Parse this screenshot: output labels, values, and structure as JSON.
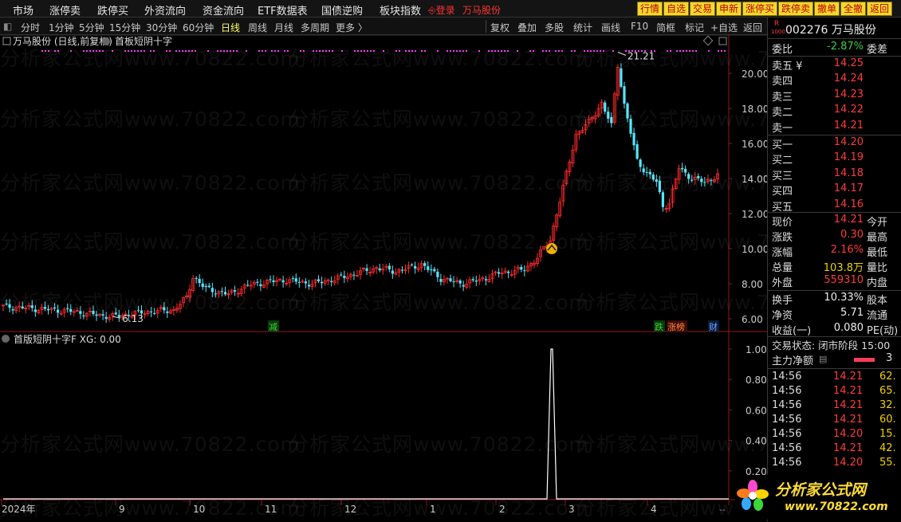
{
  "menu": {
    "items": [
      "市场",
      "涨停卖",
      "跌停买",
      "外资流向",
      "资金流向",
      "ETF数据表",
      "国债逆购",
      "板块指数"
    ],
    "login": "登录",
    "stock_name_red": "万马股份",
    "quick_buttons": [
      "行情",
      "自选",
      "交易",
      "申新",
      "涨停买",
      "跌停卖",
      "撤单",
      "全撤",
      "返回"
    ]
  },
  "toolbar": {
    "periods": [
      "分时",
      "1分钟",
      "5分钟",
      "15分钟",
      "30分钟",
      "60分钟",
      "日线",
      "周线",
      "月线",
      "多周期",
      "更多 〉"
    ],
    "active_period": "日线",
    "right_tools": [
      "复权",
      "叠加",
      "多股",
      "统计",
      "画线",
      "F10",
      "简框",
      "标记",
      "+自选",
      "返回"
    ]
  },
  "chart": {
    "title": "万马股份 (日线,前复权)",
    "indicator": "首板短阴十字",
    "price_axis": [
      "20.00",
      "18.00",
      "16.00",
      "14.00",
      "12.00",
      "10.00",
      "8.00",
      "6.00"
    ],
    "high_label": "21.21",
    "low_label": "6.13",
    "markers": {
      "reduce": "减",
      "drop": "跌",
      "limit": "涨榜",
      "fin": "财"
    },
    "sub_title": "首版短阴十字F  XG: 0.00",
    "sub_axis": [
      "1.00",
      "0.80",
      "0.60",
      "0.40",
      "0.20"
    ],
    "x_axis": [
      "2024年",
      "9",
      "10",
      "11",
      "12",
      "1",
      "2",
      "3",
      "4"
    ],
    "watermark": "分析家公式网www.70822.com"
  },
  "chart_data": {
    "type": "candlestick",
    "price_range": [
      5.5,
      21.5
    ],
    "high": 21.21,
    "low": 6.13,
    "indicator_series": {
      "name": "XG",
      "range": [
        0,
        1
      ],
      "signal_value": 1.0
    }
  },
  "panel": {
    "logo_letter": "R",
    "logo_sub": "1000",
    "code": "002276",
    "name": "万马股份",
    "weibi_label": "委比",
    "weibi_value": "-2.87%",
    "weicha_label": "委差",
    "sell": [
      {
        "label": "卖五 ¥",
        "price": "14.25"
      },
      {
        "label": "卖四",
        "price": "14.24"
      },
      {
        "label": "卖三",
        "price": "14.23"
      },
      {
        "label": "卖二",
        "price": "14.22"
      },
      {
        "label": "卖一",
        "price": "14.21"
      }
    ],
    "buy": [
      {
        "label": "买一",
        "price": "14.20"
      },
      {
        "label": "买二",
        "price": "14.19"
      },
      {
        "label": "买三",
        "price": "14.18"
      },
      {
        "label": "买四",
        "price": "14.17"
      },
      {
        "label": "买五",
        "price": "14.16"
      }
    ],
    "stats": [
      {
        "label": "现价",
        "value": "14.21",
        "color": "red",
        "right": "今开"
      },
      {
        "label": "涨跌",
        "value": "0.30",
        "color": "red",
        "right": "最高"
      },
      {
        "label": "涨幅",
        "value": "2.16%",
        "color": "red",
        "right": "最低"
      },
      {
        "label": "总量",
        "value": "103.8万",
        "color": "yellow",
        "right": "量比"
      },
      {
        "label": "外盘",
        "value": "559310",
        "color": "red",
        "right": "内盘"
      },
      {
        "label": "换手",
        "value": "10.33%",
        "color": "white",
        "right": "股本"
      },
      {
        "label": "净资",
        "value": "5.71",
        "color": "white",
        "right": "流通"
      },
      {
        "label": "收益(一)",
        "value": "0.080",
        "color": "white",
        "right": "PE(动)"
      }
    ],
    "trade_status": "交易状态: 闭市阶段 15:00",
    "main_net": "主力净额",
    "ticks": [
      {
        "time": "14:56",
        "price": "14.21",
        "vol": "62."
      },
      {
        "time": "14:56",
        "price": "14.21",
        "vol": "65."
      },
      {
        "time": "14:56",
        "price": "14.21",
        "vol": "32."
      },
      {
        "time": "14:56",
        "price": "14.21",
        "vol": "60."
      },
      {
        "time": "14:56",
        "price": "14.20",
        "vol": "15."
      },
      {
        "time": "14:56",
        "price": "14.21",
        "vol": "42."
      },
      {
        "time": "14:56",
        "price": "14.20",
        "vol": "55."
      }
    ]
  },
  "logo": {
    "text": "分析家公式网",
    "url": "www.70822.com"
  },
  "colors": {
    "up": "#ff2a2a",
    "down": "#54e8ff",
    "purple": "#ff33ff",
    "signal": "#ffffff"
  }
}
